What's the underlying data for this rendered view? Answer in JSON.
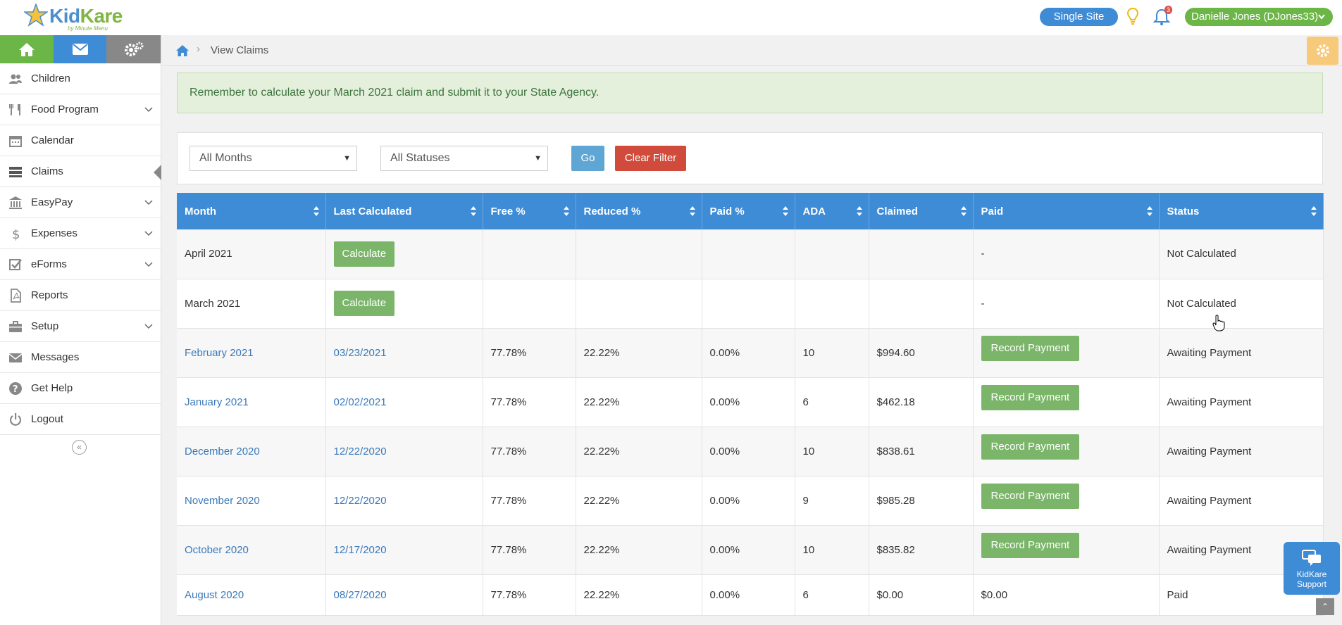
{
  "header": {
    "logo_text_1": "Kid",
    "logo_text_2": "Kare",
    "logo_sub": "by Minute Menu",
    "site_label": "Single Site",
    "notification_count": "3",
    "user_label": "Danielle Jones (DJones33)"
  },
  "sidebar": {
    "items": [
      {
        "label": "Children",
        "icon": "users-icon",
        "has_caret": false
      },
      {
        "label": "Food Program",
        "icon": "utensils-icon",
        "has_caret": true
      },
      {
        "label": "Calendar",
        "icon": "calendar-icon",
        "has_caret": false
      },
      {
        "label": "Claims",
        "icon": "server-icon",
        "has_caret": false
      },
      {
        "label": "EasyPay",
        "icon": "bank-icon",
        "has_caret": true
      },
      {
        "label": "Expenses",
        "icon": "dollar-icon",
        "has_caret": true
      },
      {
        "label": "eForms",
        "icon": "checkbox-icon",
        "has_caret": true
      },
      {
        "label": "Reports",
        "icon": "pdf-icon",
        "has_caret": false
      },
      {
        "label": "Setup",
        "icon": "briefcase-icon",
        "has_caret": true
      },
      {
        "label": "Messages",
        "icon": "envelope-icon",
        "has_caret": false
      },
      {
        "label": "Get Help",
        "icon": "question-icon",
        "has_caret": false
      },
      {
        "label": "Logout",
        "icon": "power-icon",
        "has_caret": false
      }
    ],
    "collapse_glyph": "«"
  },
  "breadcrumb": {
    "current": "View Claims",
    "separator": "›"
  },
  "alert": "Remember to calculate your March 2021 claim and submit it to your State Agency.",
  "filters": {
    "month": "All Months",
    "status": "All Statuses",
    "go_label": "Go",
    "clear_label": "Clear Filter"
  },
  "table": {
    "columns": [
      "Month",
      "Last Calculated",
      "Free %",
      "Reduced %",
      "Paid %",
      "ADA",
      "Claimed",
      "Paid",
      "Status"
    ],
    "rows": [
      {
        "month": "April 2021",
        "last": "Calculate",
        "last_is_button": true,
        "free": "",
        "reduced": "",
        "paid_pct": "",
        "ada": "",
        "claimed": "",
        "paid": "-",
        "paid_is_button": false,
        "status": "Not Calculated",
        "link": false
      },
      {
        "month": "March 2021",
        "last": "Calculate",
        "last_is_button": true,
        "free": "",
        "reduced": "",
        "paid_pct": "",
        "ada": "",
        "claimed": "",
        "paid": "-",
        "paid_is_button": false,
        "status": "Not Calculated",
        "link": false
      },
      {
        "month": "February 2021",
        "last": "03/23/2021",
        "last_is_button": false,
        "free": "77.78%",
        "reduced": "22.22%",
        "paid_pct": "0.00%",
        "ada": "10",
        "claimed": "$994.60",
        "paid": "Record Payment",
        "paid_is_button": true,
        "status": "Awaiting Payment",
        "link": true
      },
      {
        "month": "January 2021",
        "last": "02/02/2021",
        "last_is_button": false,
        "free": "77.78%",
        "reduced": "22.22%",
        "paid_pct": "0.00%",
        "ada": "6",
        "claimed": "$462.18",
        "paid": "Record Payment",
        "paid_is_button": true,
        "status": "Awaiting Payment",
        "link": true
      },
      {
        "month": "December 2020",
        "last": "12/22/2020",
        "last_is_button": false,
        "free": "77.78%",
        "reduced": "22.22%",
        "paid_pct": "0.00%",
        "ada": "10",
        "claimed": "$838.61",
        "paid": "Record Payment",
        "paid_is_button": true,
        "status": "Awaiting Payment",
        "link": true
      },
      {
        "month": "November 2020",
        "last": "12/22/2020",
        "last_is_button": false,
        "free": "77.78%",
        "reduced": "22.22%",
        "paid_pct": "0.00%",
        "ada": "9",
        "claimed": "$985.28",
        "paid": "Record Payment",
        "paid_is_button": true,
        "status": "Awaiting Payment",
        "link": true
      },
      {
        "month": "October 2020",
        "last": "12/17/2020",
        "last_is_button": false,
        "free": "77.78%",
        "reduced": "22.22%",
        "paid_pct": "0.00%",
        "ada": "10",
        "claimed": "$835.82",
        "paid": "Record Payment",
        "paid_is_button": true,
        "status": "Awaiting Payment",
        "link": true
      },
      {
        "month": "August 2020",
        "last": "08/27/2020",
        "last_is_button": false,
        "free": "77.78%",
        "reduced": "22.22%",
        "paid_pct": "0.00%",
        "ada": "6",
        "claimed": "$0.00",
        "paid": "$0.00",
        "paid_is_button": false,
        "status": "Paid",
        "link": true
      }
    ]
  },
  "support": {
    "line1": "KidKare",
    "line2": "Support"
  },
  "scroll_top_glyph": "⌃",
  "colors": {
    "green": "#6cb547",
    "blue": "#3e8bd6",
    "red": "#d14b3c",
    "alert_bg": "#e4efdc"
  }
}
